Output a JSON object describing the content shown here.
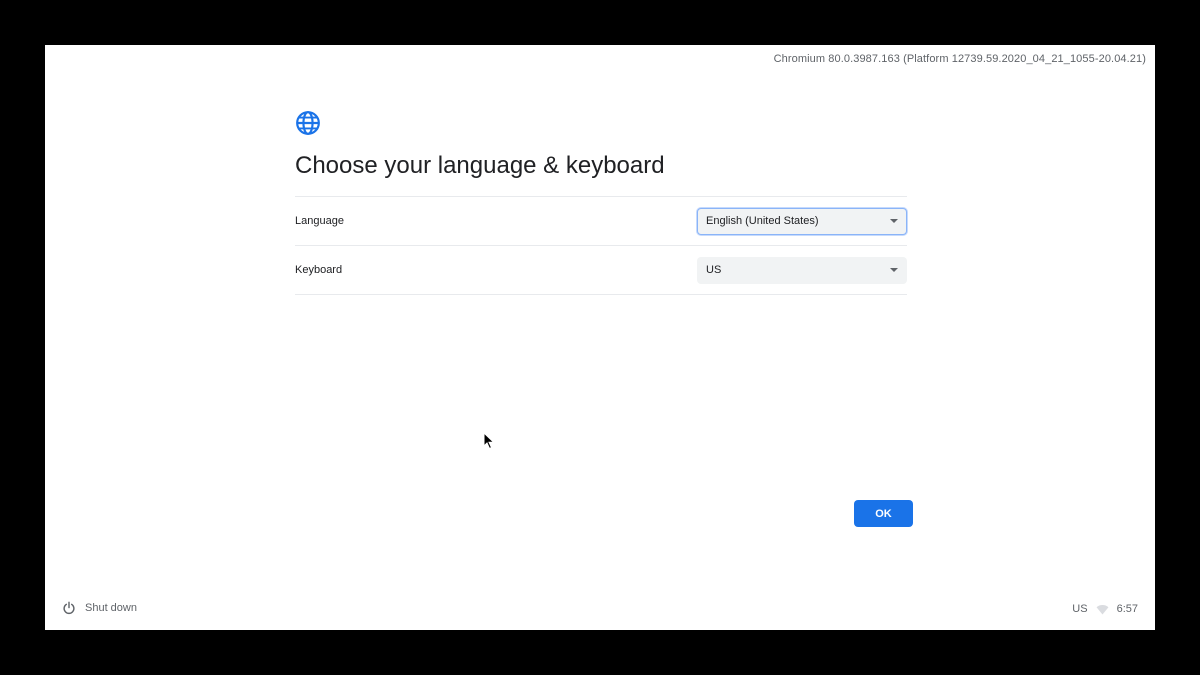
{
  "version_text": "Chromium 80.0.3987.163 (Platform 12739.59.2020_04_21_1055-20.04.21)",
  "header": {
    "icon": "globe-icon",
    "title": "Choose your language & keyboard"
  },
  "settings": {
    "language": {
      "label": "Language",
      "value": "English (United States)"
    },
    "keyboard": {
      "label": "Keyboard",
      "value": "US"
    }
  },
  "ok_label": "OK",
  "shelf": {
    "shutdown_label": "Shut down",
    "ime_indicator": "US",
    "time": "6:57"
  },
  "colors": {
    "accent": "#1a73e8",
    "background": "#ffffff"
  }
}
